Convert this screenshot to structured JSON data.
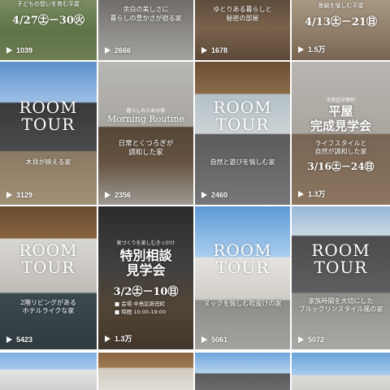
{
  "tiles": [
    {
      "views": "1039",
      "caption": "子どもの想いを育む平屋",
      "date": "4/27㊏－30㊋"
    },
    {
      "views": "2666",
      "caption": "余白の美しさに\n暮らしの豊かさが宿る家"
    },
    {
      "views": "1678",
      "caption": "ゆとりある暮らしと\n秘密の部屋"
    },
    {
      "views": "1.5万",
      "caption": "景観を愉しむ平屋",
      "date": "4/13㊏－21㊐"
    },
    {
      "views": "3129",
      "title1": "ROOM",
      "title2": "TOUR",
      "caption": "木目が映える家"
    },
    {
      "views": "2356",
      "small": "暮らしのための家",
      "title": "Morning Routine",
      "caption": "日常とくつろぎが\n調和した家"
    },
    {
      "views": "2460",
      "title1": "ROOM",
      "title2": "TOUR",
      "caption": "自然と遊びを愉しむ家"
    },
    {
      "views": "1.3万",
      "small": "中島区中野町",
      "title": "平屋\n完成見学会",
      "caption": "ライフスタイルと\n自然が調和した家",
      "date": "3/16㊏－24㊐"
    },
    {
      "views": "5423",
      "title1": "ROOM",
      "title2": "TOUR",
      "caption": "2階リビングがある\nホテルライクな家"
    },
    {
      "views": "1.3万",
      "small": "家づくりを楽しむきっかけ",
      "title": "特別相談\n見学会",
      "date": "3/2㊏－10㊐",
      "info": "■ 会場  中島区新田町\n■ 時間  10:00-19:00"
    },
    {
      "views": "5061",
      "title1": "ROOM",
      "title2": "TOUR",
      "caption": "ヌックを愉しむ吹抜けの家"
    },
    {
      "views": "5072",
      "title1": "ROOM",
      "title2": "TOUR",
      "caption": "家族時間を大切にした\nブルックリンスタイル風の家"
    },
    {
      "views": ""
    },
    {
      "views": ""
    },
    {
      "views": ""
    },
    {
      "views": ""
    }
  ]
}
